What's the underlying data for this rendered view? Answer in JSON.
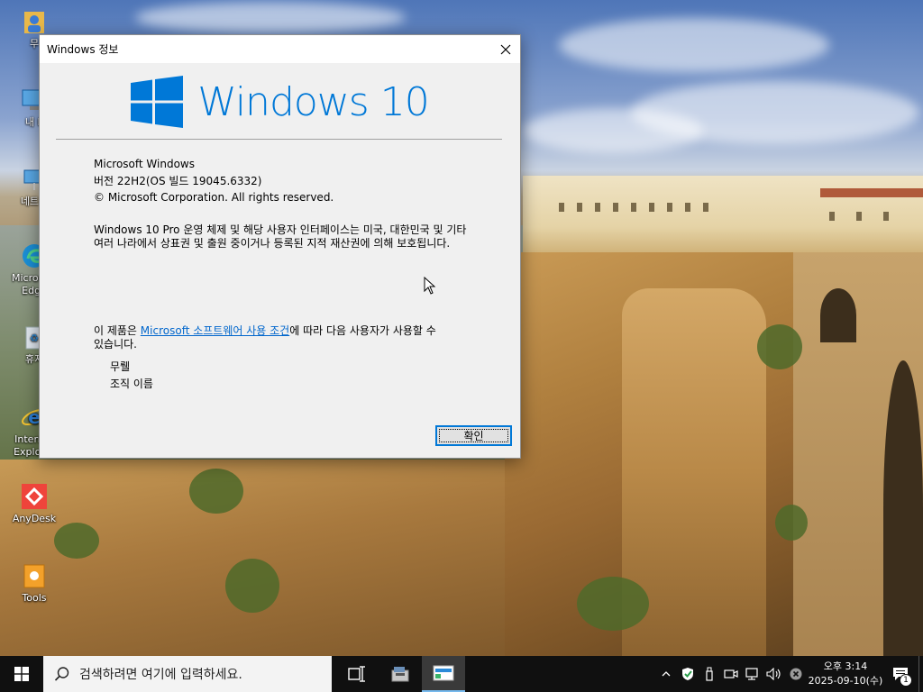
{
  "desktop": {
    "icons": [
      {
        "name": "user-folder",
        "label": "무"
      },
      {
        "name": "this-pc",
        "label": "내 P"
      },
      {
        "name": "network",
        "label": "네트워"
      },
      {
        "name": "microsoft-edge",
        "label": "Microsoft Edge"
      },
      {
        "name": "recycle-bin",
        "label": "휴지"
      },
      {
        "name": "internet-explorer",
        "label": "Internet Explorer"
      },
      {
        "name": "anydesk",
        "label": "AnyDesk"
      },
      {
        "name": "tools",
        "label": "Tools"
      }
    ]
  },
  "dialog": {
    "title": "Windows 정보",
    "brand_text": "Windows 10",
    "info": {
      "product": "Microsoft Windows",
      "version": "버전 22H2(OS 빌드 19045.6332)",
      "copyright": "© Microsoft Corporation. All rights reserved."
    },
    "description": "Windows 10 Pro 운영 체제 및 해당 사용자 인터페이스는 미국, 대한민국 및 기타 여러 나라에서 상표권 및 출원 중이거나 등록된 지적 재산권에 의해 보호됩니다.",
    "license": {
      "prefix": "이 제품은 ",
      "link_text": "Microsoft 소프트웨어 사용 조건",
      "suffix": "에 따라 다음 사용자가 사용할 수 있습니다."
    },
    "licensed_user": "무뤨",
    "licensed_org": "조직 이름",
    "ok_label": "확인"
  },
  "taskbar": {
    "search_placeholder": "검색하려면 여기에 입력하세요.",
    "clock_time": "오후 3:14",
    "clock_date": "2025-09-10(수)",
    "notification_count": "1"
  },
  "colors": {
    "accent": "#0078d7",
    "taskbar": "#101010",
    "dialog_bg": "#f0f0f0"
  }
}
